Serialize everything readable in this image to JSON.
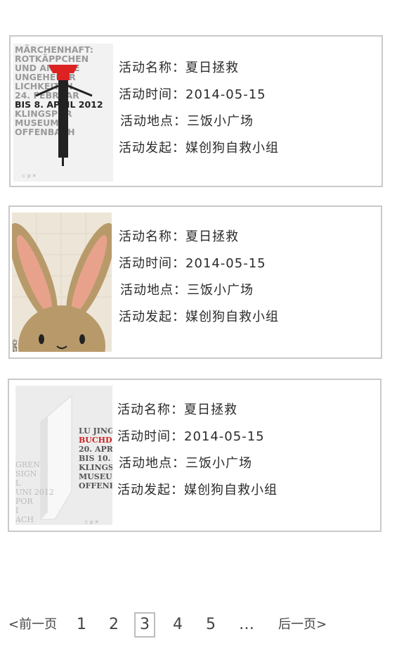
{
  "events": [
    {
      "name_label": "活动名称：",
      "name": "夏日拯救",
      "time_label": "活动时间：",
      "time": "2014-05-15",
      "place_label": "活动地点：",
      "place": "三饭小广场",
      "org_label": "活动发起：",
      "org": "媒创狗自救小组",
      "poster": {
        "type": "typography-poster",
        "lines": [
          "MÄRCHENHAFT:",
          "ROTKÄPPCHEN",
          "UND ANDERE",
          "UNGEHEUER",
          "LICHKEITEN",
          "24. FEBRUAR",
          "BIS 8. APRIL 2012",
          "KLINGSPOR",
          "MUSEUM",
          "OFFENBACH"
        ]
      }
    },
    {
      "name_label": "活动名称：",
      "name": "夏日拯救",
      "time_label": "活动时间：",
      "time": "2014-05-15",
      "place_label": "活动地点：",
      "place": "三饭小广场",
      "org_label": "活动发起：",
      "org": "媒创狗自救小组",
      "poster": {
        "type": "rabbit-poster",
        "caption": "白馬村"
      }
    },
    {
      "name_label": "活动名称：",
      "name": "夏日拯救",
      "time_label": "活动时间：",
      "time": "2014-05-15",
      "place_label": "活动地点：",
      "place": "三饭小广场",
      "org_label": "活动发起：",
      "org": "媒创狗自救小组",
      "poster": {
        "type": "book-poster",
        "lines": [
          "LU JING",
          "BUCHDE",
          "20. APRI",
          "BIS 10. J",
          "KLINGS",
          "MUSEUM",
          "OFFENB"
        ],
        "left_lines": [
          "GREN",
          "SIGN",
          "L",
          "UNI 2012",
          "POR",
          "I",
          "ACH"
        ]
      }
    }
  ],
  "pagination": {
    "prev": "<前一页",
    "pages": [
      "1",
      "2",
      "3",
      "4",
      "5"
    ],
    "current": "3",
    "ellipsis": "…",
    "next": "后一页>"
  }
}
